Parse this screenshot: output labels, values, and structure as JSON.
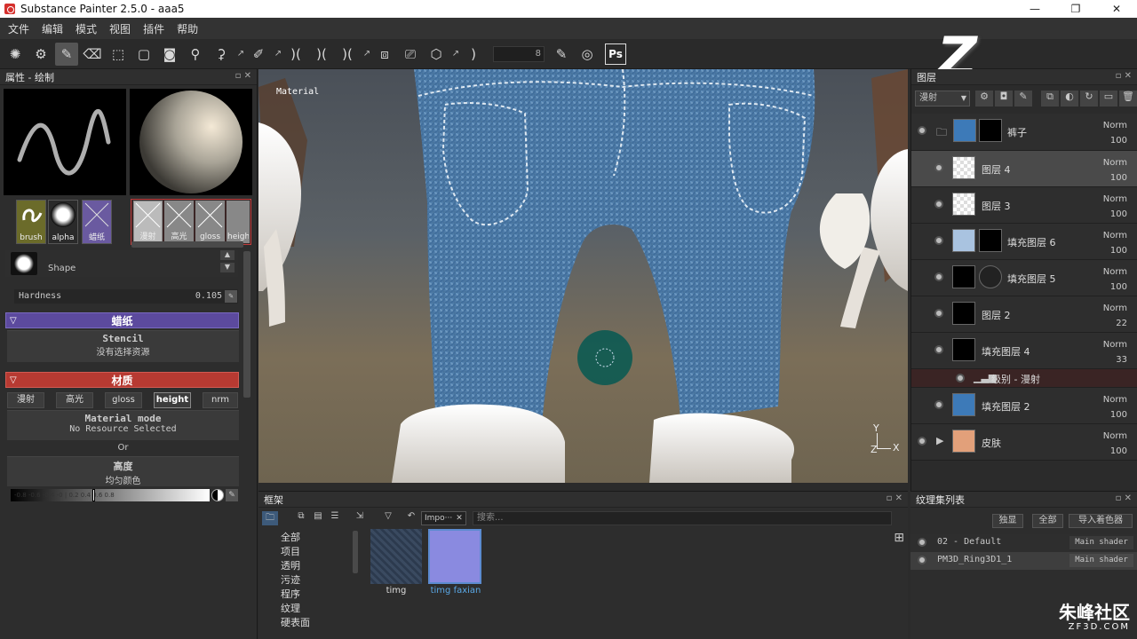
{
  "window": {
    "title": "Substance Painter 2.5.0 - aaa5",
    "minimize": "—",
    "restore": "❐",
    "close": "✕"
  },
  "menu": [
    "文件",
    "编辑",
    "模式",
    "视图",
    "插件",
    "帮助"
  ],
  "toolbar": {
    "slot_value": "8",
    "ps_label": "Ps"
  },
  "overlay_letter": "Z",
  "properties": {
    "title": "属性 - 绘制",
    "swatches": [
      {
        "label": "brush",
        "color": "#6b6b2a"
      },
      {
        "label": "alpha",
        "color": "#2a2a2a"
      },
      {
        "label": "蜡纸",
        "color": "#6a5aa0"
      }
    ],
    "channels": [
      "漫射",
      "高光",
      "gloss",
      "height"
    ],
    "shape_label": "Shape",
    "hardness_label": "Hardness",
    "hardness_value": "0.105",
    "stencil_section": "蜡纸",
    "stencil_title": "Stencil",
    "stencil_sub": "没有选择资源",
    "material_section": "材质",
    "material_buttons": [
      "漫射",
      "高光",
      "gloss",
      "height",
      "nrm"
    ],
    "material_mode": "Material mode",
    "material_mode_sub": "No Resource Selected",
    "or_label": "Or",
    "height_label": "高度",
    "height_sub": "均匀颜色",
    "slider_ticks": "-0.8  -0.6 -0.4  -0  |  0.2  0.4  0.6  0.8"
  },
  "viewport": {
    "label": "Material",
    "axis_y": "Y",
    "axis_x": "X",
    "axis_z": "Z"
  },
  "layers": {
    "title": "图层",
    "blend_mode": "漫射",
    "rows": [
      {
        "name": "裤子",
        "mode": "Norm",
        "opacity": "100"
      },
      {
        "name": "图层 4",
        "mode": "Norm",
        "opacity": "100"
      },
      {
        "name": "图层 3",
        "mode": "Norm",
        "opacity": "100"
      },
      {
        "name": "填充图层 6",
        "mode": "Norm",
        "opacity": "100"
      },
      {
        "name": "填充图层 5",
        "mode": "Norm",
        "opacity": "100"
      },
      {
        "name": "图层 2",
        "mode": "Norm",
        "opacity": "22"
      },
      {
        "name": "填充图层 4",
        "mode": "Norm",
        "opacity": "33"
      },
      {
        "name": "级别 - 漫射"
      },
      {
        "name": "填充图层 2",
        "mode": "Norm",
        "opacity": "100"
      },
      {
        "name": "皮肤",
        "mode": "Norm",
        "opacity": "100"
      }
    ]
  },
  "shelf": {
    "title": "框架",
    "search_placeholder": "搜索...",
    "filter_tag": "Impo···",
    "categories": [
      "全部",
      "项目",
      "透明",
      "污迹",
      "程序",
      "纹理",
      "硬表面"
    ],
    "items": [
      {
        "name": "timg"
      },
      {
        "name": "timg faxian"
      }
    ]
  },
  "texture_list": {
    "title": "纹理集列表",
    "buttons": [
      "独显",
      "全部",
      "导入着色器"
    ],
    "rows": [
      {
        "name": "02 - Default",
        "shader": "Main shader"
      },
      {
        "name": "PM3D_Ring3D1_1",
        "shader": "Main shader"
      }
    ]
  },
  "watermark": {
    "line1": "朱峰社区",
    "line2": "ZF3D.COM"
  }
}
